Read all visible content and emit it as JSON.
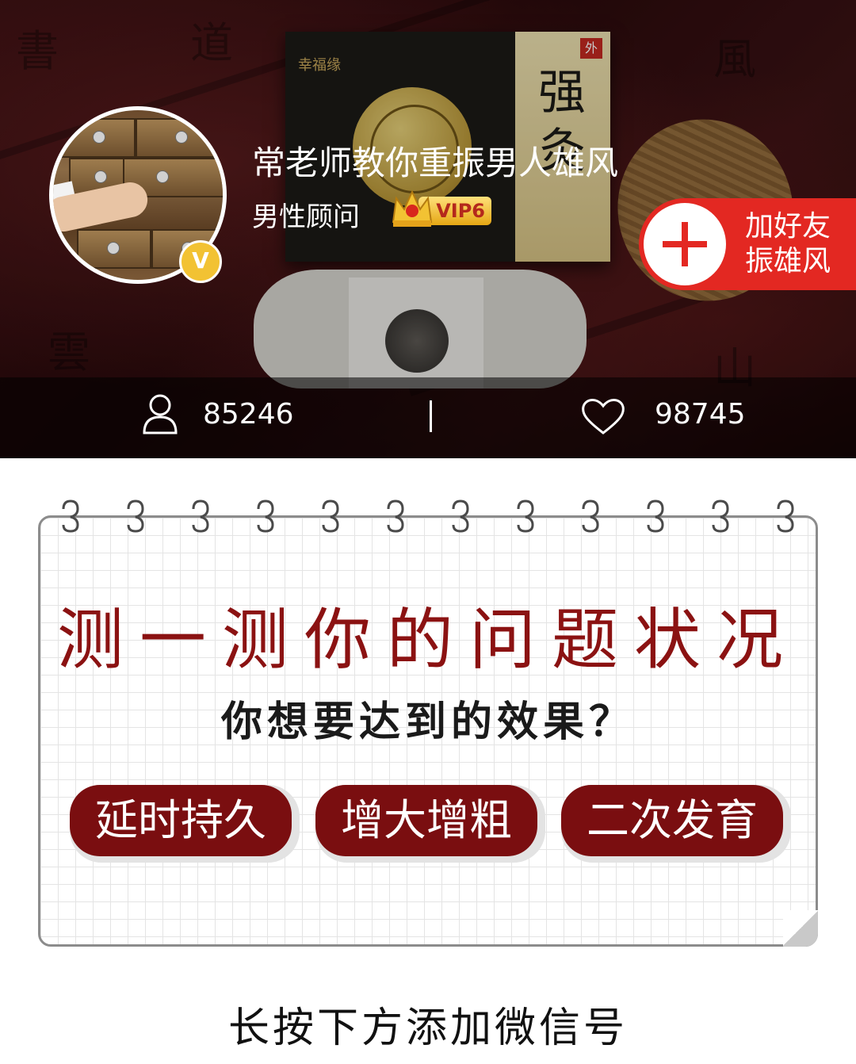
{
  "profile": {
    "name": "常老师教你重振男人雄风",
    "role": "男性顾问",
    "vip_label": "VIP6",
    "verified_mark": "V"
  },
  "add_friend": {
    "line1": "加好友",
    "line2": "振雄风"
  },
  "stats": {
    "followers": "85246",
    "likes": "98745"
  },
  "quiz": {
    "title": "测一测你的问题状况",
    "subtitle": "你想要达到的效果？",
    "options": [
      "延时持久",
      "增大增粗",
      "二次发育"
    ]
  },
  "footer": {
    "text": "长按下方添加微信号"
  },
  "colors": {
    "accent_red": "#e32822",
    "title_dark_red": "#8b1212",
    "option_bg": "#7a0e10",
    "vip_gold": "#f2c233"
  }
}
